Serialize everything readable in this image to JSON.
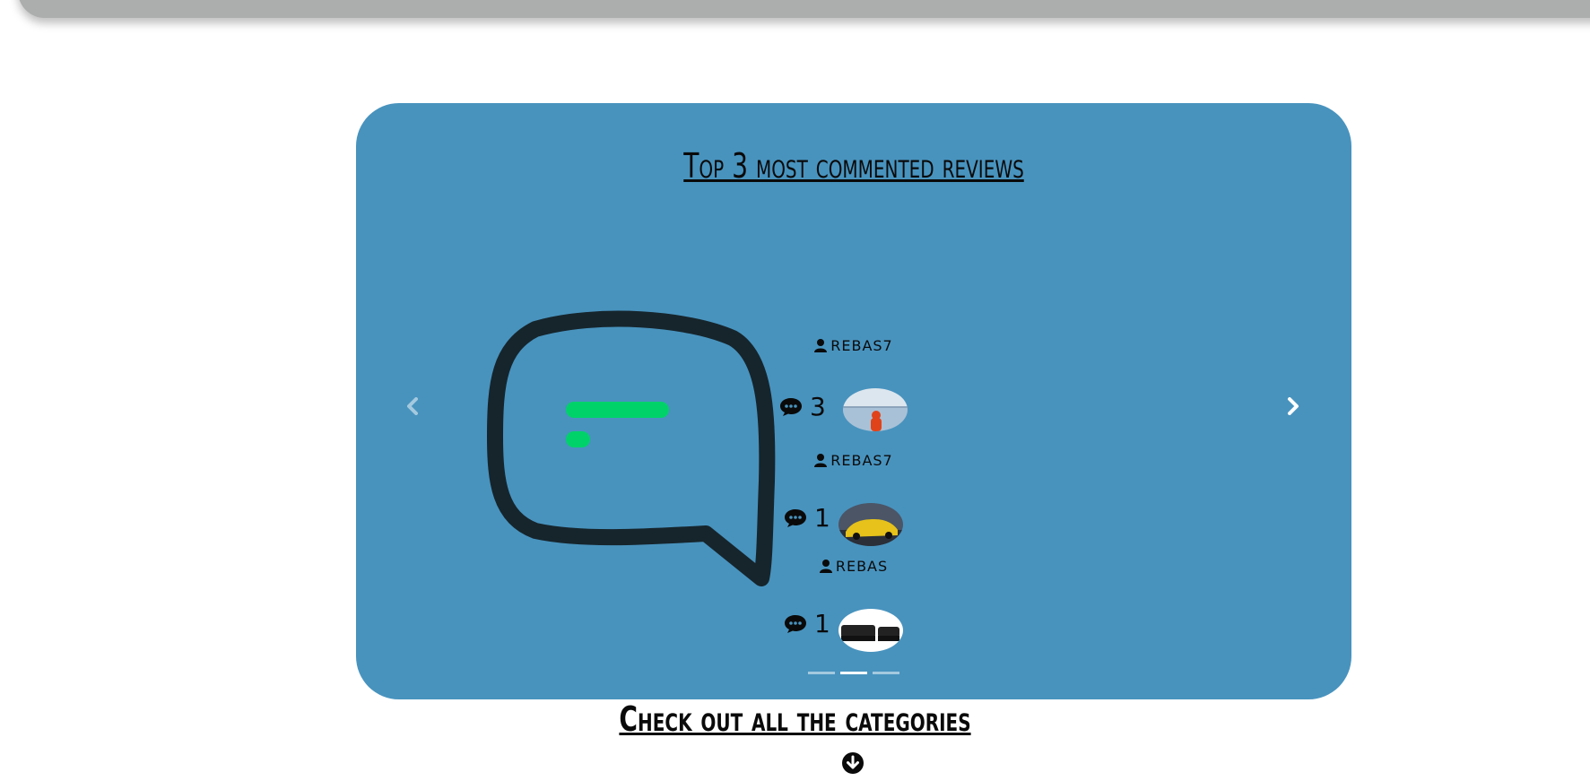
{
  "carousel": {
    "title": "Top 3 most commented reviews",
    "reviews": [
      {
        "author": "REBAS7",
        "comments": "3"
      },
      {
        "author": "REBAS7",
        "comments": "1"
      },
      {
        "author": "REBAS",
        "comments": "1"
      }
    ],
    "indicator_count": 3,
    "active_indicator": 2
  },
  "categories": {
    "title": "Check out all the categories"
  },
  "colors": {
    "card_bg": "#4893be",
    "bubble_stroke": "#16252c",
    "bubble_lines": "#00d26a"
  }
}
